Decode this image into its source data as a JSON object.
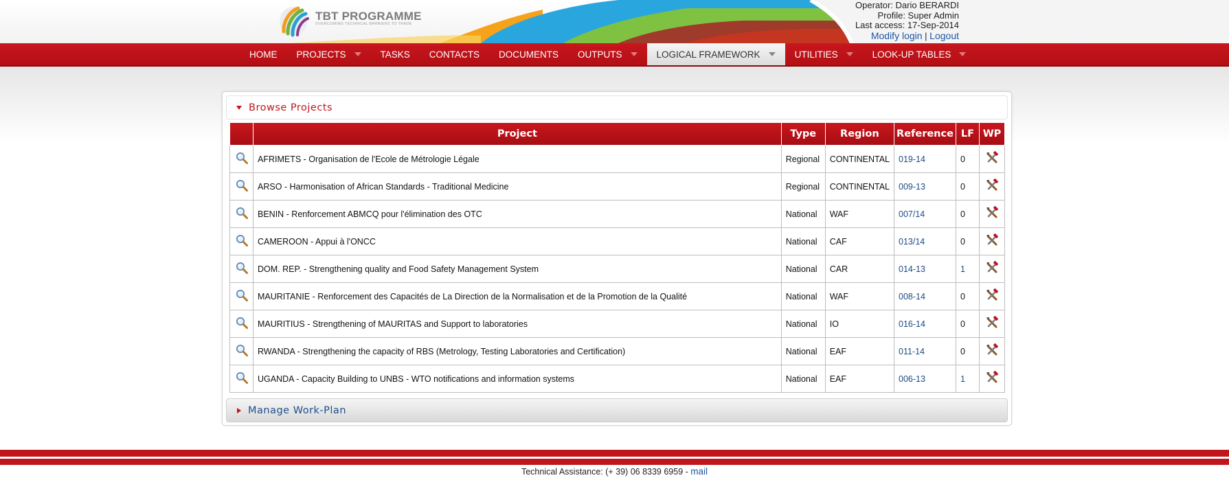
{
  "header": {
    "logo_title": "TBT PROGRAMME",
    "logo_tagline": "OVERCOMING TECHNICAL BARRIERS TO TRADE",
    "operator": "Operator: Dario BERARDI",
    "profile": "Profile: Super Admin",
    "last_access": "Last access: 17-Sep-2014",
    "modify_login": "Modify login",
    "separator": "|",
    "logout": "Logout"
  },
  "nav": {
    "items": [
      {
        "label": "HOME",
        "dropdown": false
      },
      {
        "label": "PROJECTS",
        "dropdown": true
      },
      {
        "label": "TASKS",
        "dropdown": false
      },
      {
        "label": "CONTACTS",
        "dropdown": false
      },
      {
        "label": "DOCUMENTS",
        "dropdown": false
      },
      {
        "label": "OUTPUTS",
        "dropdown": true
      },
      {
        "label": "LOGICAL FRAMEWORK",
        "dropdown": true,
        "active": true
      },
      {
        "label": "UTILITIES",
        "dropdown": true
      },
      {
        "label": "LOOK-UP TABLES",
        "dropdown": true
      }
    ]
  },
  "browse": {
    "title": "Browse Projects",
    "columns": {
      "project": "Project",
      "type": "Type",
      "region": "Region",
      "reference": "Reference",
      "lf": "LF",
      "wp": "WP"
    },
    "rows": [
      {
        "project": "AFRIMETS - Organisation de l'Ecole de Métrologie Légale",
        "type": "Regional",
        "region": "CONTINENTAL",
        "reference": "019-14",
        "lf": "0"
      },
      {
        "project": "ARSO - Harmonisation of African Standards - Traditional Medicine",
        "type": "Regional",
        "region": "CONTINENTAL",
        "reference": "009-13",
        "lf": "0"
      },
      {
        "project": "BENIN - Renforcement ABMCQ pour l'élimination des OTC",
        "type": "National",
        "region": "WAF",
        "reference": "007/14",
        "lf": "0"
      },
      {
        "project": "CAMEROON - Appui à l'ONCC",
        "type": "National",
        "region": "CAF",
        "reference": "013/14",
        "lf": "0"
      },
      {
        "project": "DOM. REP. - Strengthening quality and Food Safety Management System",
        "type": "National",
        "region": "CAR",
        "reference": "014-13",
        "lf": "1"
      },
      {
        "project": "MAURITANIE - Renforcement des Capacités de La Direction de la Normalisation et de la Promotion de la Qualité",
        "type": "National",
        "region": "WAF",
        "reference": "008-14",
        "lf": "0"
      },
      {
        "project": "MAURITIUS - Strengthening of MAURITAS and Support to laboratories",
        "type": "National",
        "region": "IO",
        "reference": "016-14",
        "lf": "0"
      },
      {
        "project": "RWANDA - Strengthening the capacity of RBS (Metrology, Testing Laboratories and Certification)",
        "type": "National",
        "region": "EAF",
        "reference": "011-14",
        "lf": "0"
      },
      {
        "project": "UGANDA - Capacity Building to UNBS - WTO notifications and information systems",
        "type": "National",
        "region": "EAF",
        "reference": "006-13",
        "lf": "1"
      }
    ],
    "view_icon": "magnifier-icon",
    "wp_icon": "tools-icon"
  },
  "workplan": {
    "title": "Manage Work-Plan"
  },
  "footer": {
    "text": "Technical Assistance: (+ 39) 06 8339 6959 -",
    "mail": "mail"
  },
  "colors": {
    "brand_red": "#c0151b",
    "link_blue": "#1e56a0"
  }
}
